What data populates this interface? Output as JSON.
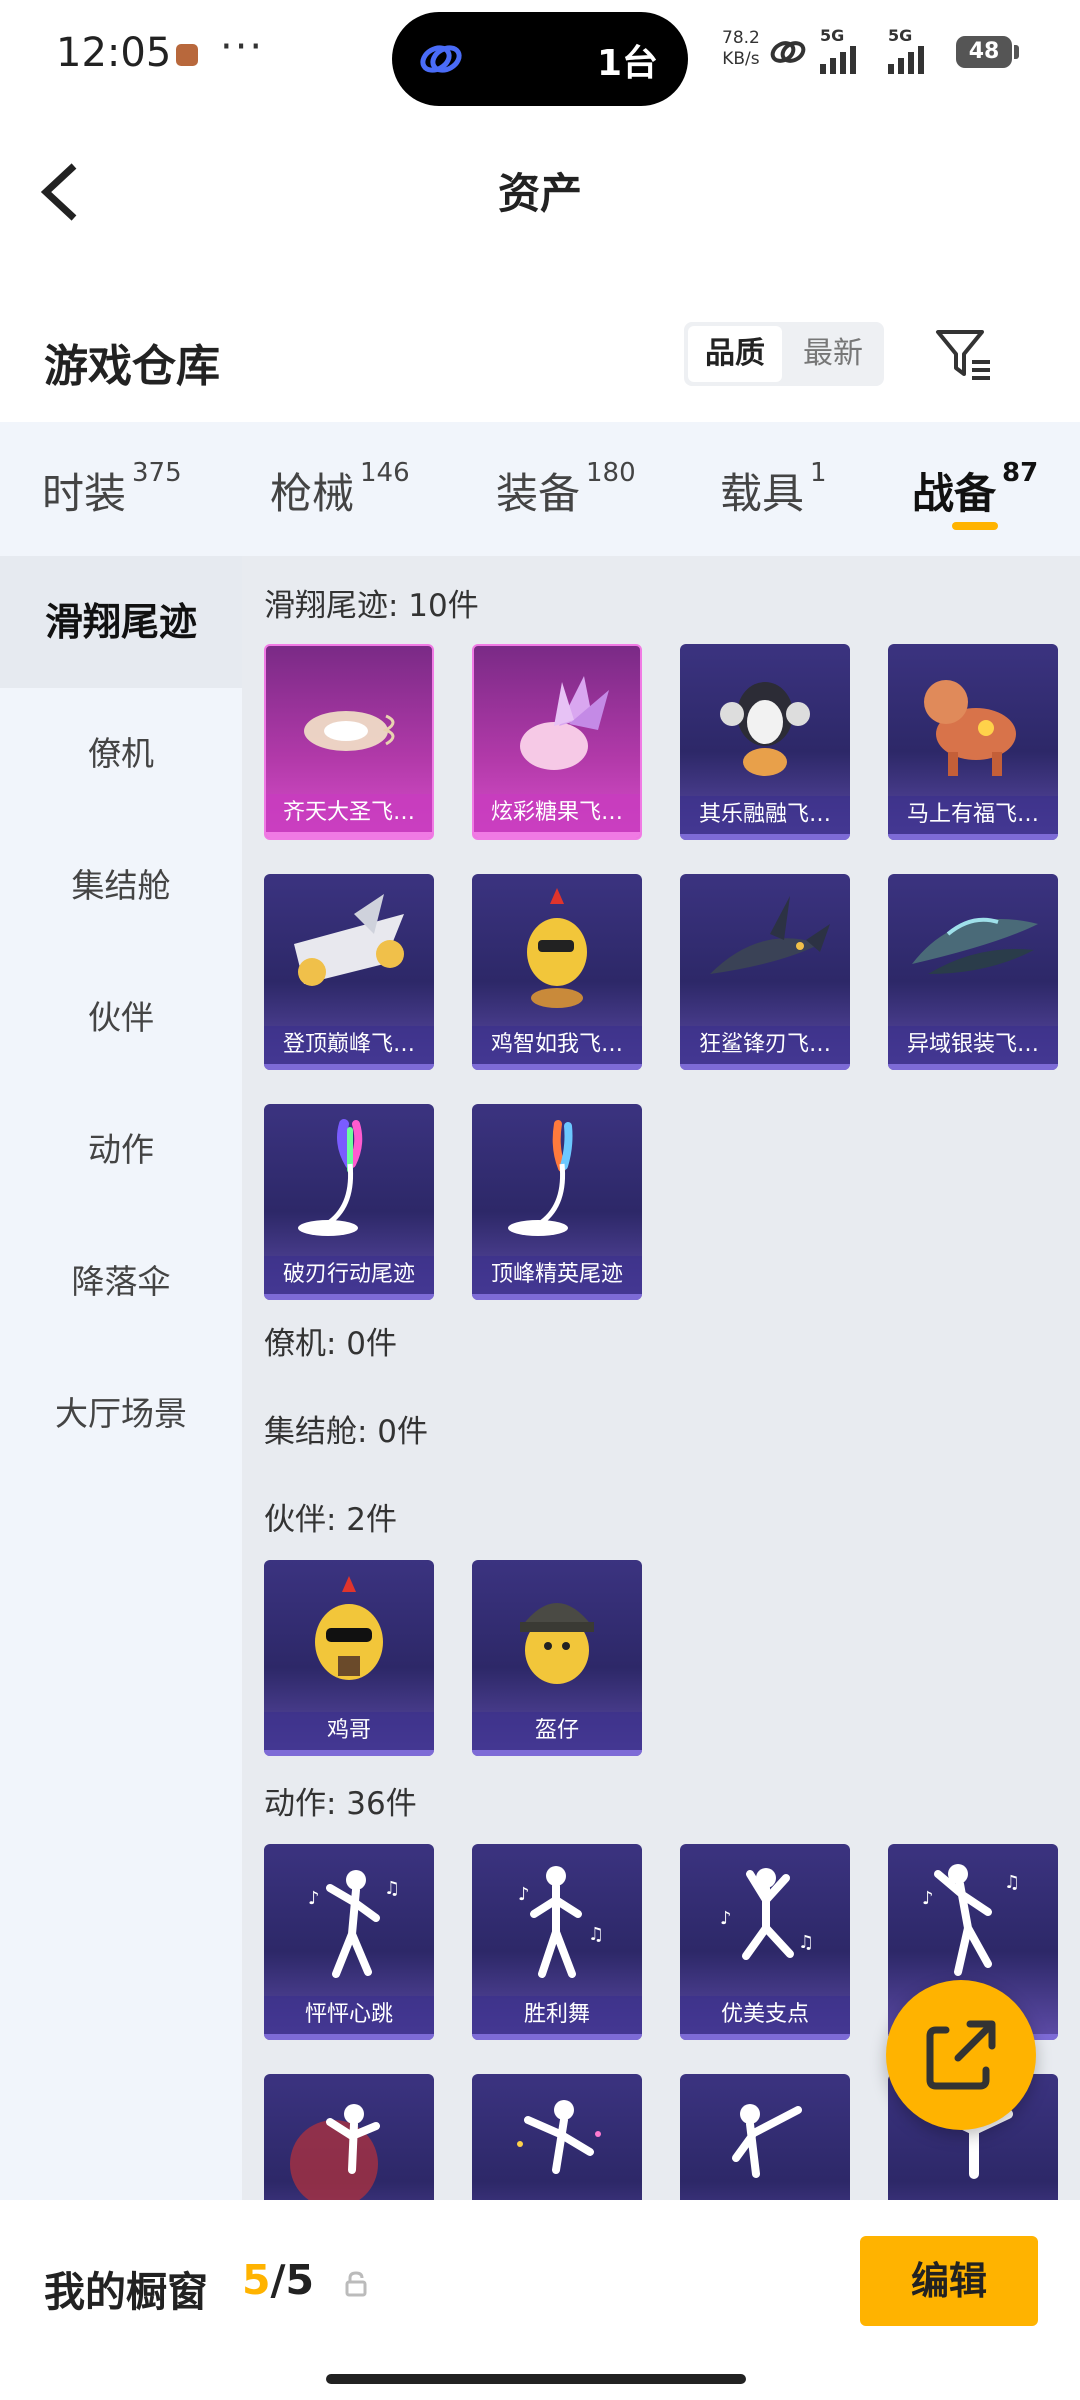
{
  "status_bar": {
    "time": "12:05",
    "island_text": "1台",
    "speed_value": "78.2",
    "speed_unit": "KB/s",
    "signal_1": "5G",
    "signal_2": "5G",
    "battery": "48"
  },
  "header": {
    "title": "资产"
  },
  "section": {
    "title": "游戏仓库",
    "sort_options": [
      "品质",
      "最新"
    ],
    "active_sort": "品质"
  },
  "tabs": [
    {
      "label": "时装",
      "count": "375"
    },
    {
      "label": "枪械",
      "count": "146"
    },
    {
      "label": "装备",
      "count": "180"
    },
    {
      "label": "载具",
      "count": "1"
    },
    {
      "label": "战备",
      "count": "87",
      "active": true
    }
  ],
  "sidebar": {
    "items": [
      "滑翔尾迹",
      "僚机",
      "集结舱",
      "伙伴",
      "动作",
      "降落伞",
      "大厅场景"
    ],
    "active": "滑翔尾迹"
  },
  "groups": {
    "trail": {
      "title": "滑翔尾迹: 10件",
      "items": [
        "齐天大圣飞…",
        "炫彩糖果飞…",
        "其乐融融飞…",
        "马上有福飞…",
        "登顶巅峰飞…",
        "鸡智如我飞…",
        "狂鲨锋刃飞…",
        "异域银装飞…",
        "破刃行动尾迹",
        "顶峰精英尾迹"
      ]
    },
    "wingman": {
      "title": "僚机: 0件"
    },
    "pod": {
      "title": "集结舱: 0件"
    },
    "partner": {
      "title": "伙伴: 2件",
      "items": [
        "鸡哥",
        "盔仔"
      ]
    },
    "emote": {
      "title": "动作: 36件",
      "items": [
        "怦怦心跳",
        "胜利舞",
        "优美支点"
      ]
    }
  },
  "bottom_bar": {
    "label": "我的橱窗",
    "current": "5",
    "separator": "/",
    "total": "5",
    "edit_label": "编辑"
  },
  "colors": {
    "accent": "#ffb300",
    "card_purple": "#3b3380",
    "card_pink": "#b33aaa"
  }
}
